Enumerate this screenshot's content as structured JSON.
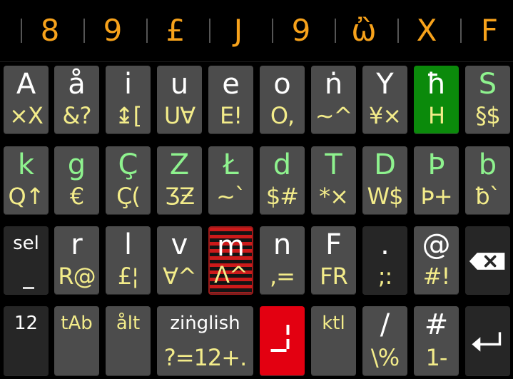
{
  "suggestions": [
    "8",
    "9",
    "£",
    "J",
    "9",
    "ὢ",
    "X",
    "F"
  ],
  "rows": [
    [
      {
        "id": "a",
        "main": "A",
        "sub": "×X"
      },
      {
        "id": "a-ring",
        "main": "å",
        "sub": "&?"
      },
      {
        "id": "i",
        "main": "i",
        "sub": "↨["
      },
      {
        "id": "u",
        "main": "u",
        "sub": "U∀"
      },
      {
        "id": "e",
        "main": "e",
        "sub": "E!"
      },
      {
        "id": "o",
        "main": "o",
        "sub": "O,"
      },
      {
        "id": "n-ring",
        "main": "ṅ",
        "sub": "~^"
      },
      {
        "id": "y",
        "main": "Y",
        "sub": "¥×"
      },
      {
        "id": "h",
        "main": "ħ",
        "sub": "H",
        "style": "green"
      },
      {
        "id": "s",
        "main": "S",
        "sub": "§$",
        "mainGreen": true
      }
    ],
    [
      {
        "id": "k",
        "main": "k",
        "sub": "Q↑",
        "mainGreen": true
      },
      {
        "id": "g",
        "main": "g",
        "sub": "€",
        "mainGreen": true
      },
      {
        "id": "c-cedilla",
        "main": "Ç",
        "sub": "Ç(",
        "mainGreen": true
      },
      {
        "id": "z",
        "main": "Z",
        "sub": "ƷƵ",
        "mainGreen": true
      },
      {
        "id": "l-stroke",
        "main": "Ł",
        "sub": "~`",
        "mainGreen": true
      },
      {
        "id": "d",
        "main": "d",
        "sub": "$#",
        "mainGreen": true
      },
      {
        "id": "t",
        "main": "T",
        "sub": "*×",
        "mainGreen": true
      },
      {
        "id": "d-cap",
        "main": "D",
        "sub": "W$",
        "mainGreen": true
      },
      {
        "id": "thorn",
        "main": "Þ",
        "sub": "Þ+",
        "mainGreen": true
      },
      {
        "id": "b",
        "main": "b",
        "sub": "ƀ`",
        "mainGreen": true
      }
    ],
    [
      {
        "id": "sel",
        "main": "sel",
        "sub": "",
        "style": "dark",
        "small": true,
        "dash": true
      },
      {
        "id": "r",
        "main": "r",
        "sub": "R@"
      },
      {
        "id": "l",
        "main": "l",
        "sub": "£¦"
      },
      {
        "id": "v",
        "main": "v",
        "sub": "∀^"
      },
      {
        "id": "m",
        "main": "m",
        "sub": "Λ^",
        "style": "striped"
      },
      {
        "id": "n",
        "main": "n",
        "sub": ",="
      },
      {
        "id": "f",
        "main": "F",
        "sub": "FR"
      },
      {
        "id": "dot",
        "main": ".",
        "sub": ";:",
        "style": "dark"
      },
      {
        "id": "at",
        "main": "@",
        "sub": "#!"
      },
      {
        "id": "backspace",
        "main": "",
        "sub": "",
        "style": "dark",
        "icon": "backspace"
      }
    ]
  ],
  "bottom": [
    {
      "id": "num",
      "main": "12",
      "sub": "",
      "style": "dark",
      "small": true
    },
    {
      "id": "tab",
      "main": "tAb",
      "sub": "",
      "small": true,
      "mainYellow": true
    },
    {
      "id": "alt",
      "main": "ålt",
      "sub": "",
      "small": true,
      "mainYellow": true
    },
    {
      "id": "space",
      "main": "ziṅglish",
      "sub": "?=12+.",
      "small": true
    },
    {
      "id": "cursor",
      "main": "",
      "sub": "",
      "style": "red",
      "icon": "cursor"
    },
    {
      "id": "ctrl",
      "main": "ktl",
      "sub": "",
      "small": true,
      "mainYellow": true
    },
    {
      "id": "slash",
      "main": "/",
      "sub": "\\%"
    },
    {
      "id": "hash",
      "main": "#",
      "sub": "1-"
    },
    {
      "id": "enter",
      "main": "",
      "sub": "",
      "style": "dark",
      "icon": "enter"
    }
  ]
}
